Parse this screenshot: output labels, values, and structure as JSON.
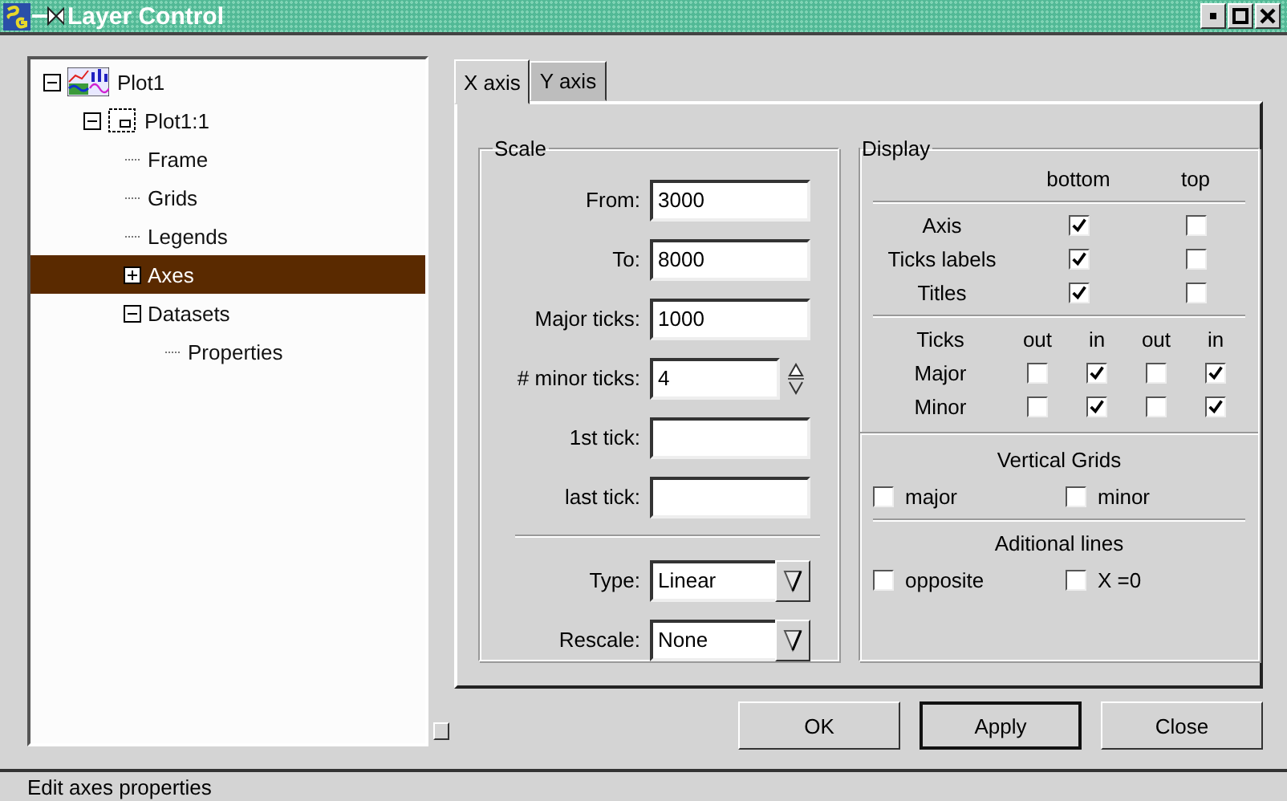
{
  "window": {
    "title": "Layer Control"
  },
  "tree": [
    {
      "label": "Plot1",
      "kind": "plot",
      "expanded": true,
      "selected": false,
      "children": [
        {
          "label": "Plot1:1",
          "kind": "layer",
          "expanded": true,
          "selected": false,
          "children": [
            {
              "label": "Frame",
              "selected": false
            },
            {
              "label": "Grids",
              "selected": false
            },
            {
              "label": "Legends",
              "selected": false
            },
            {
              "label": "Axes",
              "expanded": false,
              "selected": true
            },
            {
              "label": "Datasets",
              "expanded": true,
              "selected": false,
              "children": [
                {
                  "label": "Properties",
                  "selected": false
                }
              ]
            }
          ]
        }
      ]
    }
  ],
  "tabs": [
    {
      "label": "X axis",
      "selected": true
    },
    {
      "label": "Y axis",
      "selected": false
    }
  ],
  "scale": {
    "title": "Scale",
    "fields": [
      {
        "kind": "text",
        "label": "From:",
        "value": "3000"
      },
      {
        "kind": "text",
        "label": "To:",
        "value": "8000"
      },
      {
        "kind": "text",
        "label": "Major ticks:",
        "value": "1000"
      },
      {
        "kind": "spin",
        "label": "# minor ticks:",
        "value": "4"
      },
      {
        "kind": "text",
        "label": "1st tick:"
      },
      {
        "kind": "text",
        "label": "last tick:"
      },
      {
        "kind": "combo",
        "label": "Type:",
        "value": "Linear"
      },
      {
        "kind": "combo",
        "label": "Rescale:",
        "value": "None"
      }
    ]
  },
  "display": {
    "title": "Display",
    "columns": [
      "bottom",
      "top"
    ],
    "rows": [
      {
        "label": "Axis",
        "checks": [
          {
            "checked": true
          },
          {
            "checked": false
          }
        ]
      },
      {
        "label": "Ticks labels",
        "checks": [
          {
            "checked": true
          },
          {
            "checked": false
          }
        ]
      },
      {
        "label": "Titles",
        "checks": [
          {
            "checked": true
          },
          {
            "checked": false
          }
        ]
      }
    ],
    "ticks": {
      "header": "Ticks",
      "columns": [
        "out",
        "in",
        "out",
        "in"
      ],
      "rows": [
        {
          "label": "Major",
          "checks": [
            {
              "checked": false
            },
            {
              "checked": true
            },
            {
              "checked": false
            },
            {
              "checked": true
            }
          ]
        },
        {
          "label": "Minor",
          "checks": [
            {
              "checked": false
            },
            {
              "checked": true
            },
            {
              "checked": false
            },
            {
              "checked": true
            }
          ]
        }
      ]
    },
    "vertical_grids": {
      "title": "Vertical Grids",
      "options": [
        {
          "label": "major",
          "checked": false
        },
        {
          "label": "minor",
          "checked": false
        }
      ]
    },
    "additional_lines": {
      "title": "Aditional lines",
      "options": [
        {
          "label": "opposite",
          "checked": false
        },
        {
          "label": "X =0",
          "checked": false
        }
      ]
    }
  },
  "buttons": [
    {
      "label": "OK",
      "default": false
    },
    {
      "label": "Apply",
      "default": true
    },
    {
      "label": "Close",
      "default": false
    }
  ],
  "status_bar": "Edit axes properties"
}
